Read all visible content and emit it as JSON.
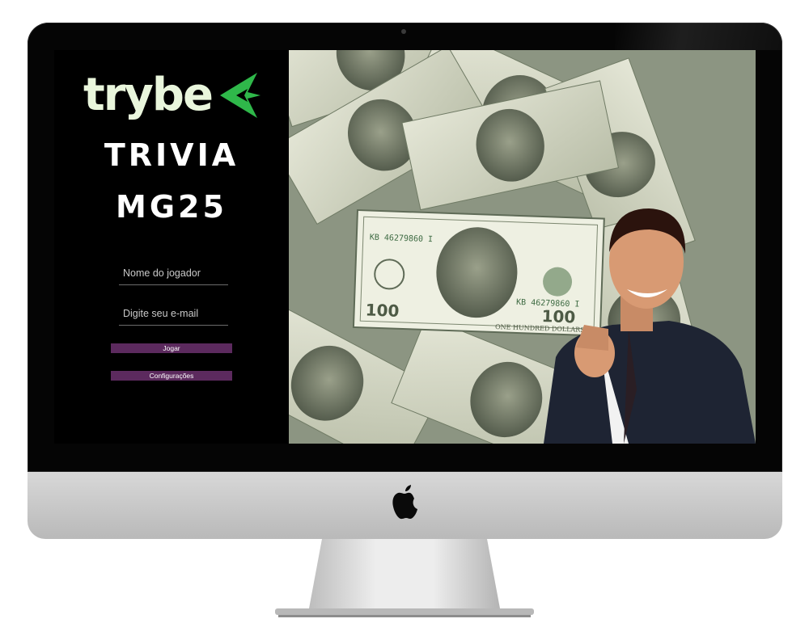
{
  "brand": {
    "logo_text": "trybe",
    "logo_color": "#e9f6dc",
    "logo_mark_color": "#2fb84a"
  },
  "title": {
    "line1": "TRIVIA",
    "line2": "MG25"
  },
  "form": {
    "name_placeholder": "Nome do jogador",
    "email_placeholder": "Digite seu e-mail",
    "play_label": "Jogar",
    "settings_label": "Configurações",
    "button_color": "#5c2a5e"
  },
  "hero": {
    "banknote_denomination": "100",
    "banknote_serial": "KB 46279860 I",
    "banknote_text": "ONE HUNDRED DOLLARS"
  }
}
